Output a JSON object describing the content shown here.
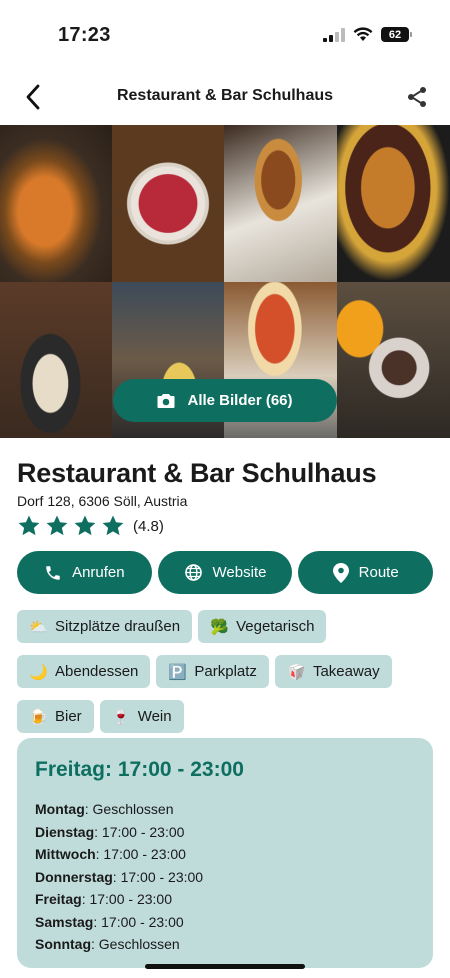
{
  "status_bar": {
    "time": "17:23",
    "battery": "62"
  },
  "nav": {
    "title": "Restaurant & Bar Schulhaus",
    "back_icon": "chevron-left-icon",
    "share_icon": "share-icon"
  },
  "gallery": {
    "button_label": "Alle Bilder (66)",
    "button_icon": "camera-icon"
  },
  "restaurant": {
    "name": "Restaurant & Bar Schulhaus",
    "address": "Dorf 128, 6306 Söll, Austria",
    "rating": 4.8,
    "rating_label": "(4.8)",
    "stars": 4
  },
  "actions": {
    "call": "Anrufen",
    "website": "Website",
    "route": "Route"
  },
  "tags": [
    {
      "emoji": "⛅",
      "label": "Sitzplätze draußen"
    },
    {
      "emoji": "🥦",
      "label": "Vegetarisch"
    },
    {
      "emoji": "🌙",
      "label": "Abendessen"
    },
    {
      "emoji": "🅿️",
      "label": "Parkplatz"
    },
    {
      "emoji": "🥡",
      "label": "Takeaway"
    },
    {
      "emoji": "🍺",
      "label": "Bier"
    },
    {
      "emoji": "🍷",
      "label": "Wein"
    }
  ],
  "hours": {
    "today": "Freitag: 17:00 - 23:00",
    "days": [
      {
        "day": "Montag",
        "time": ": Geschlossen"
      },
      {
        "day": "Dienstag",
        "time": ": 17:00 - 23:00"
      },
      {
        "day": "Mittwoch",
        "time": ": 17:00 - 23:00"
      },
      {
        "day": "Donnerstag",
        "time": ": 17:00 - 23:00"
      },
      {
        "day": "Freitag",
        "time": ": 17:00 - 23:00"
      },
      {
        "day": "Samstag",
        "time": ": 17:00 - 23:00"
      },
      {
        "day": "Sonntag",
        "time": ": Geschlossen"
      }
    ]
  },
  "colors": {
    "accent": "#0e6f61",
    "chip_bg": "#bfdcdb"
  }
}
